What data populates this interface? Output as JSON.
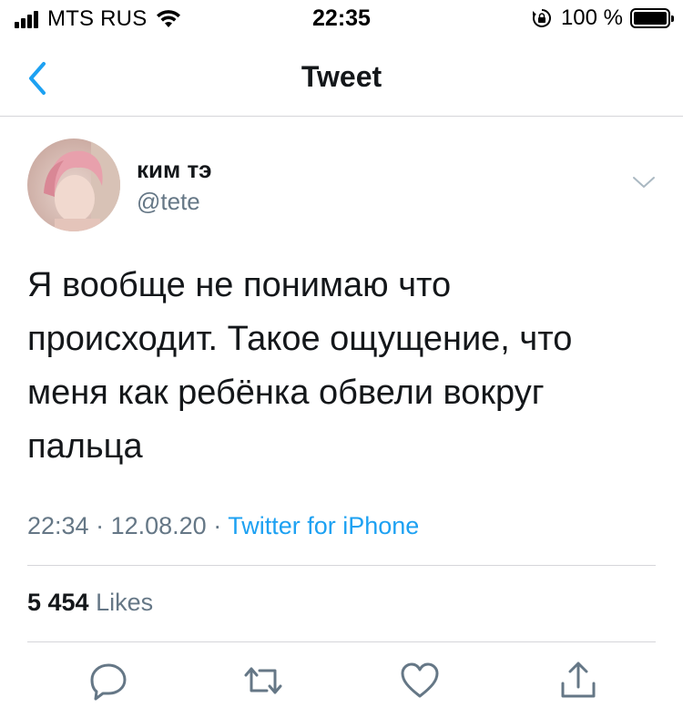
{
  "status_bar": {
    "carrier": "MTS RUS",
    "time": "22:35",
    "battery_percent": "100 %"
  },
  "nav": {
    "title": "Tweet",
    "back_icon": "chevron-left-icon"
  },
  "tweet": {
    "display_name": "ким тэ",
    "handle": "@tete",
    "text": "Я вообще не понимаю что\nпроисходит. Такое ощущение, что\nменя как ребёнка обвели вокруг\nпальца",
    "time": "22:34",
    "date": "12.08.20",
    "source": "Twitter for iPhone",
    "likes_count": "5 454",
    "likes_label": "Likes"
  },
  "actions": [
    "reply-icon",
    "retweet-icon",
    "like-icon",
    "share-icon"
  ],
  "colors": {
    "accent": "#1da1f2",
    "secondary_text": "#657786",
    "primary_text": "#14171a",
    "divider": "#d6d6da"
  }
}
